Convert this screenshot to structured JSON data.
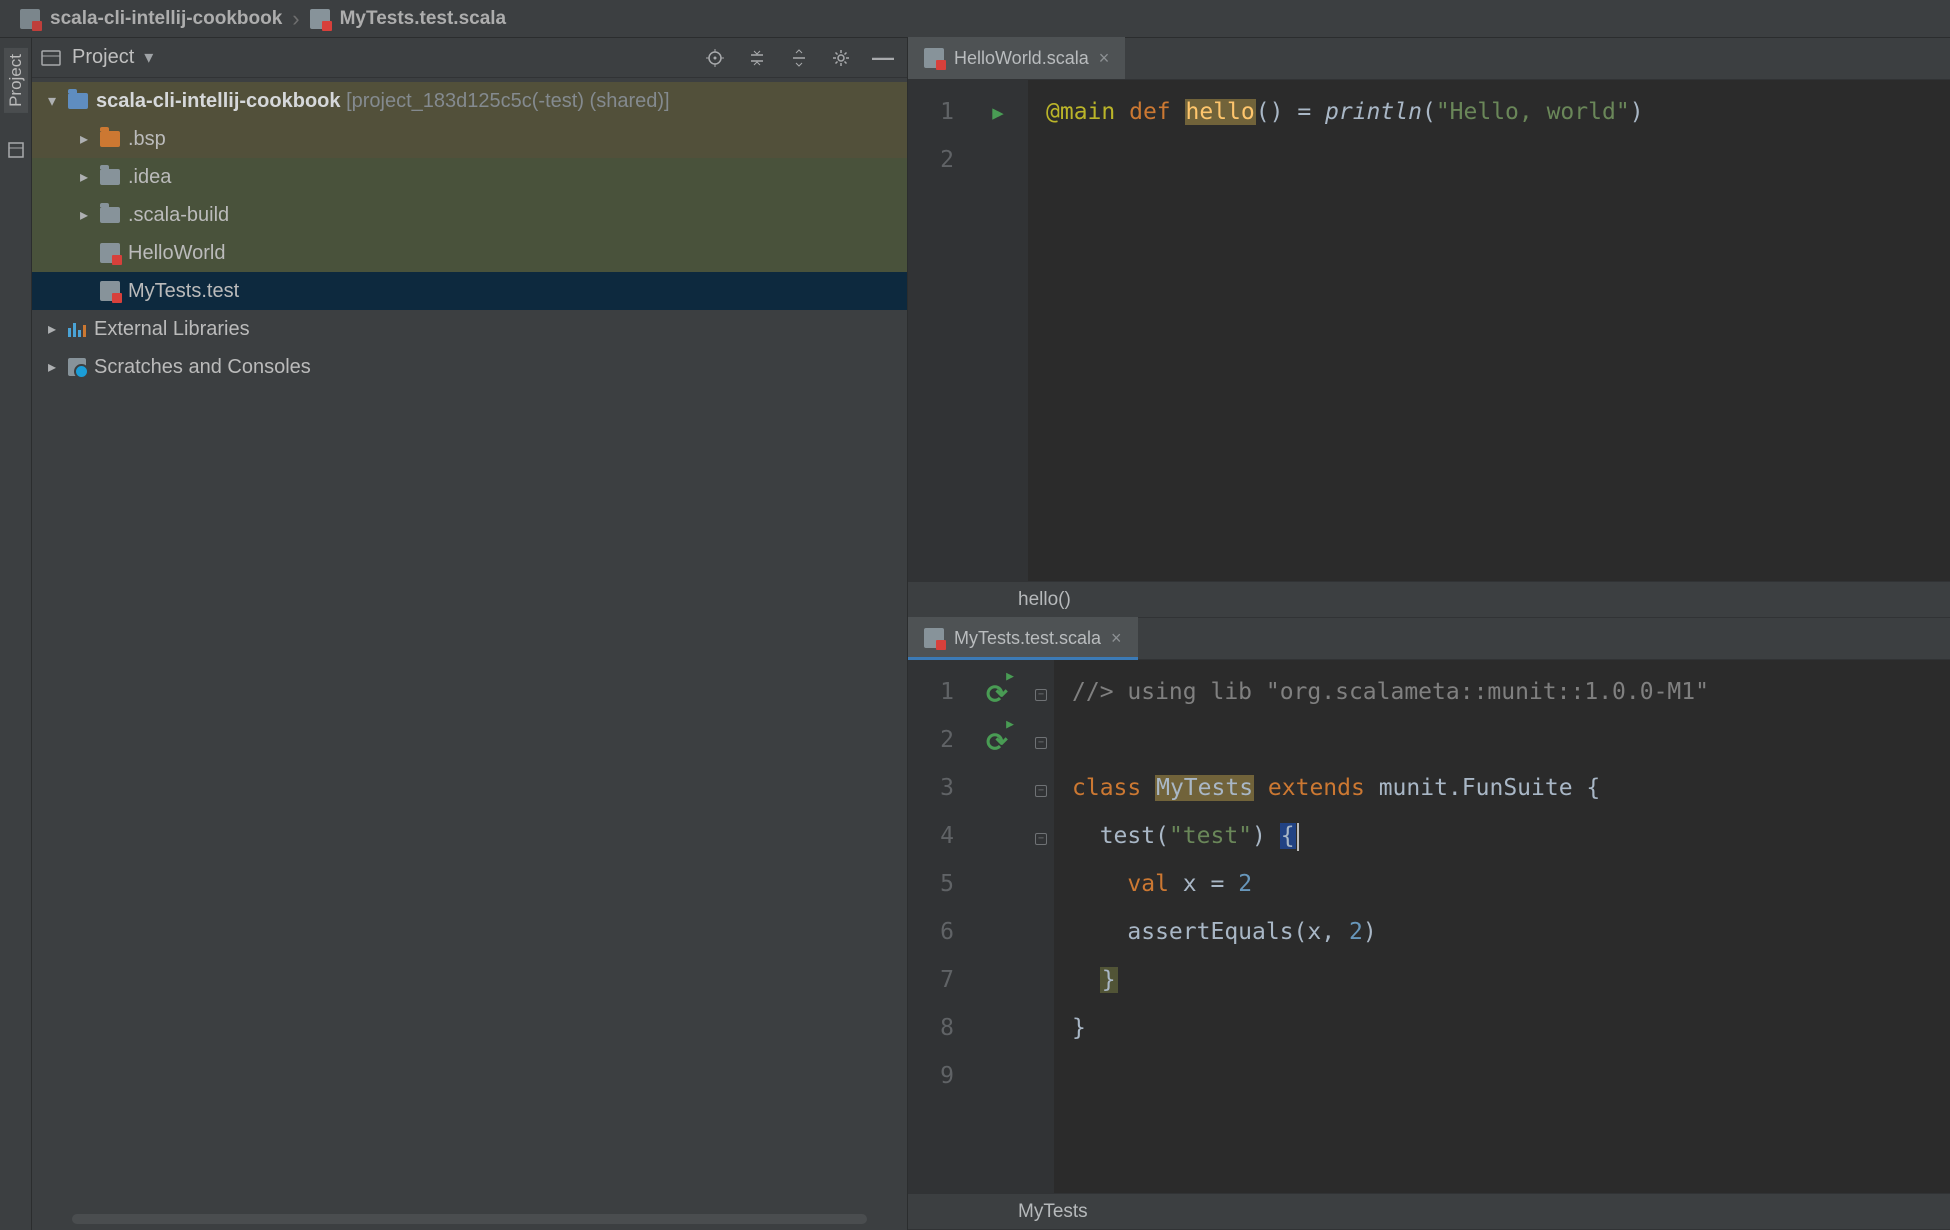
{
  "breadcrumb": {
    "root": "scala-cli-intellij-cookbook",
    "file": "MyTests.test.scala"
  },
  "project_panel": {
    "title": "Project",
    "tree": {
      "root": {
        "name": "scala-cli-intellij-cookbook",
        "suffix": " [project_183d125c5c(-test) (shared)]"
      },
      "bsp": ".bsp",
      "idea": ".idea",
      "scala_build": ".scala-build",
      "hello": "HelloWorld",
      "mytests": "MyTests.test",
      "external": "External Libraries",
      "scratches": "Scratches and Consoles"
    }
  },
  "editor_top": {
    "tab": "HelloWorld.scala",
    "crumb": "hello()",
    "lines": [
      "1",
      "2"
    ],
    "code": {
      "ann": "@main",
      "def": "def",
      "fn": "hello",
      "paren": "()",
      "eq": " = ",
      "pl": "println",
      "op": "(",
      "str": "\"Hello, world\"",
      "cp": ")"
    }
  },
  "editor_bot": {
    "tab": "MyTests.test.scala",
    "crumb": "MyTests",
    "lines": [
      "1",
      "2",
      "3",
      "4",
      "5",
      "6",
      "7",
      "8",
      "9"
    ],
    "code": {
      "l1": "//> using lib \"org.scalameta::munit::1.0.0-M1\"",
      "class": "class",
      "name": "MyTests",
      "extends": "extends",
      "suite": " munit.FunSuite {",
      "test_pre": "  test(",
      "test_str": "\"test\"",
      "test_post": ") ",
      "ob": "{",
      "val": "val",
      "x_line": " x = ",
      "two": "2",
      "assert": "    assertEquals(x, ",
      "assert_end": ")",
      "cb1": "}",
      "cb2": "}"
    }
  },
  "left_rail": {
    "project": "Project"
  }
}
